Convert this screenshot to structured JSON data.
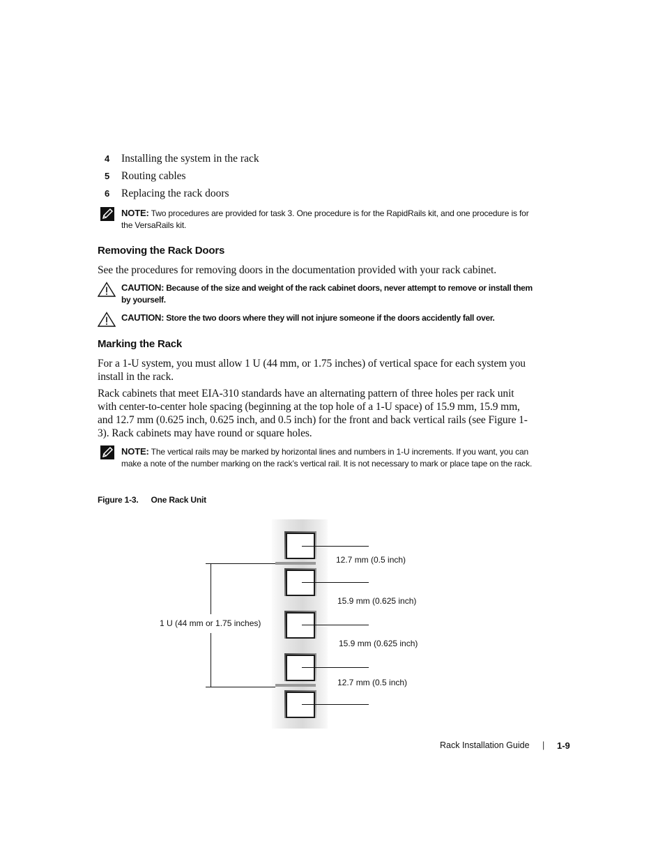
{
  "steps": [
    {
      "number": "4",
      "text": "Installing the system in the rack"
    },
    {
      "number": "5",
      "text": "Routing cables"
    },
    {
      "number": "6",
      "text": "Replacing the rack doors"
    }
  ],
  "note1": {
    "icon": "pencil-note-icon",
    "label": "NOTE:",
    "text": " Two procedures are provided for task 3. One procedure is for the RapidRails kit, and one procedure is for the VersaRails kit."
  },
  "section1": {
    "heading": "Removing the Rack Doors",
    "paragraph": "See the procedures for removing doors in the documentation provided with your rack cabinet."
  },
  "caution1": {
    "icon": "warning-triangle-icon",
    "label": "CAUTION:",
    "text": " Because of the size and weight of the rack cabinet doors, never attempt to remove or install them by yourself."
  },
  "caution2": {
    "icon": "warning-triangle-icon",
    "label": "CAUTION:",
    "text": " Store the two doors where they will not injure someone if the doors accidently fall over."
  },
  "section2": {
    "heading": "Marking the Rack",
    "paragraph1": "For a 1-U system, you must allow 1 U (44 mm, or 1.75 inches) of vertical space for each system you install in the rack.",
    "paragraph2": "Rack cabinets that meet EIA-310 standards have an alternating pattern of three holes per rack unit with center-to-center hole spacing (beginning at the top hole of a 1-U space) of 15.9 mm, 15.9 mm, and 12.7 mm (0.625 inch, 0.625 inch, and 0.5 inch) for the front and back vertical rails (see Figure 1-3). Rack cabinets may have round or square holes."
  },
  "note2": {
    "icon": "pencil-note-icon",
    "label": "NOTE:",
    "text": " The vertical rails may be marked by horizontal lines and numbers in 1-U increments. If you want, you can make a note of the number marking on the rack’s vertical rail. It is not necessary to mark or place tape on the rack."
  },
  "figure": {
    "number": "Figure 1-3.",
    "title": "One Rack Unit",
    "unit_label": "1 U (44 mm or 1.75 inches)",
    "spacing_labels": [
      "12.7 mm (0.5 inch)",
      "15.9 mm (0.625 inch)",
      "15.9 mm (0.625 inch)",
      "12.7 mm (0.5 inch)"
    ]
  },
  "footer": {
    "guide_title": "Rack Installation Guide",
    "separator": "|",
    "page_number": "1-9"
  }
}
